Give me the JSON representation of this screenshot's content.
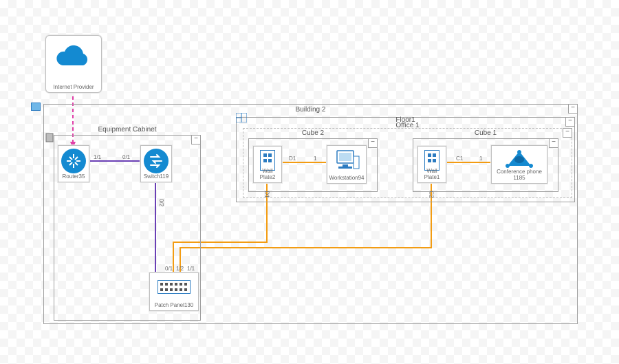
{
  "nodes": {
    "internet": {
      "label": "Internet Provider"
    },
    "building2": {
      "label": "Building 2"
    },
    "floor1": {
      "label": "Floor1"
    },
    "office1": {
      "label": "Office 1"
    },
    "cube1": {
      "label": "Cube 1"
    },
    "cube2": {
      "label": "Cube 2"
    },
    "equip_cabinet": {
      "label": "Equipment Cabinet"
    },
    "router": {
      "label": "Router35"
    },
    "switch": {
      "label": "Switch119"
    },
    "patch_panel": {
      "label": "Patch Panel130"
    },
    "wallplate1": {
      "label": "Wall Plate1"
    },
    "wallplate2": {
      "label": "Wall Plate2"
    },
    "workstation": {
      "label": "Workstation94"
    },
    "confphone": {
      "label": "Conference phone 1185"
    }
  },
  "edges": {
    "router_switch_l": "1/1",
    "router_switch_r": "0/1",
    "switch_patch": "0/2",
    "patch_top": "0/1",
    "patch_mid_l": "1/2",
    "patch_mid_r": "1/1",
    "wp2_ws_l": "D1",
    "wp2_ws_r": "1",
    "wp1_cp_l": "C1",
    "wp1_cp_r": "1",
    "wp2_down": "D1",
    "wp1_down": "C2"
  },
  "collapse_glyph": "−"
}
